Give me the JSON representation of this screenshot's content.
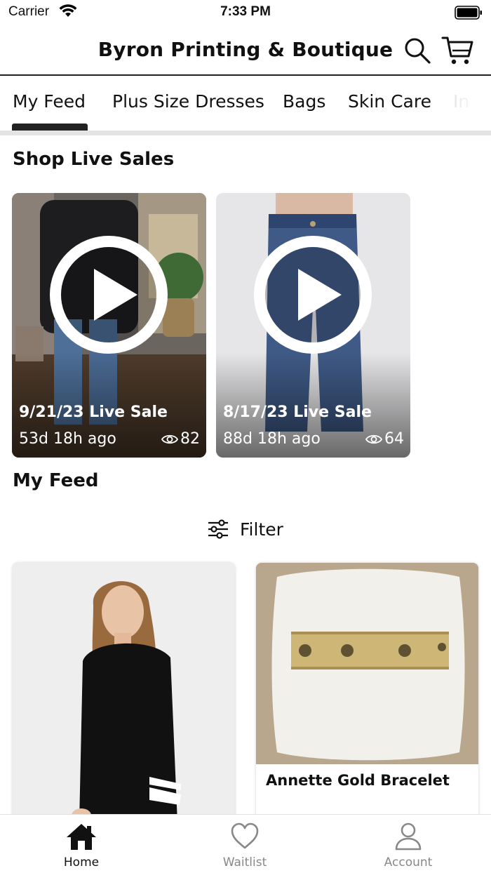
{
  "status_bar": {
    "carrier": "Carrier",
    "time": "7:33 PM"
  },
  "header": {
    "title": "Byron Printing & Boutique"
  },
  "tabs": [
    {
      "label": "My Feed",
      "active": true
    },
    {
      "label": "Plus Size Dresses"
    },
    {
      "label": "Bags"
    },
    {
      "label": "Skin Care"
    },
    {
      "label": "In"
    }
  ],
  "live_section": {
    "heading": "Shop Live Sales",
    "cards": [
      {
        "title": "9/21/23 Live Sale",
        "ago": "53d 18h ago",
        "views": "82"
      },
      {
        "title": "8/17/23 Live Sale",
        "ago": "88d 18h ago",
        "views": "64"
      }
    ]
  },
  "feed_section": {
    "heading": "My Feed",
    "filter_label": "Filter",
    "products": [
      {
        "name": ""
      },
      {
        "name": "Annette Gold Bracelet"
      }
    ]
  },
  "bottom_nav": [
    {
      "label": "Home",
      "icon": "home-icon",
      "active": true
    },
    {
      "label": "Waitlist",
      "icon": "heart-icon"
    },
    {
      "label": "Account",
      "icon": "person-icon"
    }
  ],
  "colors": {
    "accent": "#111111",
    "inactive": "#888888"
  }
}
